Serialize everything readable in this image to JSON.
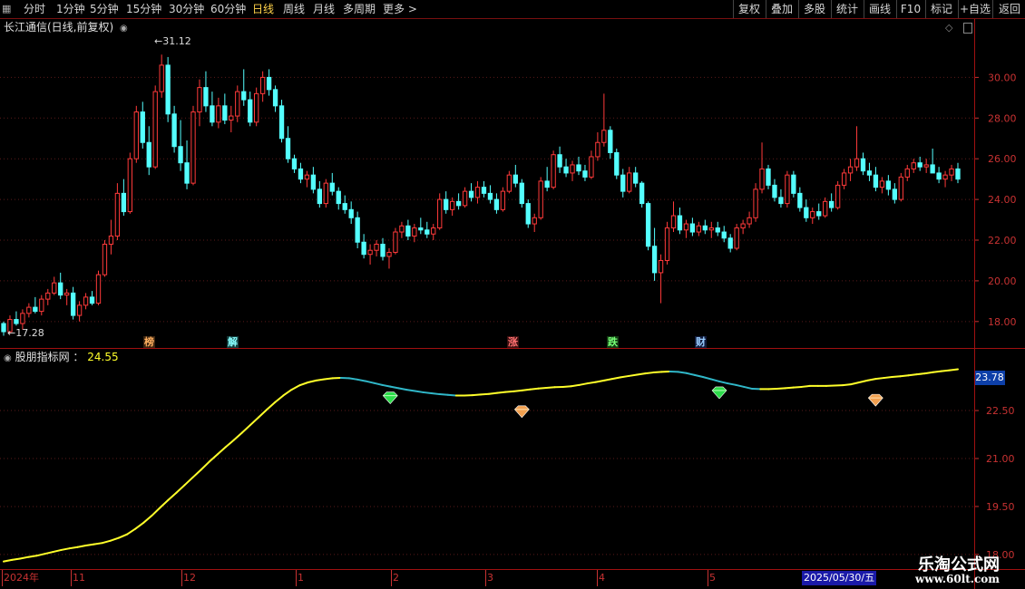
{
  "toolbar": {
    "periods": [
      "分时",
      "1分钟",
      "5分钟",
      "15分钟",
      "30分钟",
      "60分钟",
      "日线",
      "周线",
      "月线",
      "多周期",
      "更多"
    ],
    "active": "日线",
    "right_buttons": [
      "复权",
      "叠加",
      "多股",
      "统计",
      "画线",
      "F10",
      "标记",
      "+自选",
      "返回"
    ]
  },
  "main_panel": {
    "title": "长江通信(日线,前复权)",
    "high_label": "31.12",
    "low_label": "17.28",
    "events": [
      "榜",
      "解",
      "涨",
      "跌",
      "财"
    ]
  },
  "indicator_panel": {
    "title": "股朋指标网",
    "value": "24.55",
    "current_box": "23.78"
  },
  "footer": {
    "date_box": "2025/05/30/五",
    "watermark_title": "乐淘公式网",
    "watermark_url": "www.60lt.com"
  },
  "colors": {
    "up": "#ff3a3a",
    "down": "#54ffff",
    "line_up": "#ffff2a",
    "line_down": "#30b7c8",
    "grid": "#5a1a1a",
    "axis": "#c83232"
  },
  "chart_data": [
    {
      "type": "candlestick",
      "ylim": [
        16.7,
        32.2
      ],
      "y_ticks": [
        18,
        20,
        22,
        24,
        26,
        28,
        30
      ],
      "x_month_labels": [
        "2024年",
        "11",
        "12",
        "1",
        "2",
        "3",
        "4",
        "5"
      ],
      "ohlc": [
        [
          17.9,
          18.0,
          17.3,
          17.5
        ],
        [
          17.5,
          18.3,
          17.4,
          18.1
        ],
        [
          18.1,
          18.5,
          17.8,
          17.9
        ],
        [
          17.9,
          18.6,
          17.6,
          18.4
        ],
        [
          18.4,
          18.9,
          18.2,
          18.7
        ],
        [
          18.7,
          19.2,
          18.4,
          18.5
        ],
        [
          18.5,
          19.3,
          18.3,
          19.1
        ],
        [
          19.1,
          19.6,
          18.8,
          19.4
        ],
        [
          19.4,
          20.2,
          19.3,
          19.9
        ],
        [
          19.9,
          20.4,
          19.1,
          19.3
        ],
        [
          19.3,
          19.6,
          18.8,
          19.4
        ],
        [
          19.4,
          19.7,
          18.1,
          18.3
        ],
        [
          18.3,
          19.0,
          18.0,
          18.8
        ],
        [
          18.8,
          19.4,
          18.6,
          19.2
        ],
        [
          19.2,
          19.5,
          18.8,
          18.9
        ],
        [
          18.9,
          20.5,
          18.8,
          20.3
        ],
        [
          20.3,
          22.0,
          20.2,
          21.8
        ],
        [
          21.8,
          23.0,
          21.3,
          22.2
        ],
        [
          22.2,
          24.8,
          22.0,
          24.3
        ],
        [
          24.3,
          25.0,
          23.2,
          23.4
        ],
        [
          23.4,
          26.3,
          23.3,
          26.0
        ],
        [
          26.0,
          28.6,
          25.8,
          28.3
        ],
        [
          28.3,
          28.8,
          26.5,
          26.8
        ],
        [
          26.8,
          27.6,
          25.2,
          25.6
        ],
        [
          25.6,
          29.6,
          25.5,
          29.3
        ],
        [
          29.3,
          31.12,
          29.0,
          30.6
        ],
        [
          30.6,
          31.0,
          27.8,
          28.2
        ],
        [
          28.2,
          28.6,
          26.3,
          26.6
        ],
        [
          26.6,
          27.9,
          25.4,
          25.8
        ],
        [
          25.8,
          26.9,
          24.5,
          24.8
        ],
        [
          24.8,
          28.6,
          24.7,
          28.3
        ],
        [
          28.3,
          29.9,
          27.6,
          29.5
        ],
        [
          29.5,
          30.3,
          28.3,
          28.6
        ],
        [
          28.6,
          29.3,
          27.6,
          27.8
        ],
        [
          27.8,
          29.0,
          27.5,
          28.6
        ],
        [
          28.6,
          29.2,
          27.7,
          27.9
        ],
        [
          27.9,
          28.6,
          27.3,
          28.1
        ],
        [
          28.1,
          29.6,
          27.8,
          29.3
        ],
        [
          29.3,
          30.4,
          28.6,
          28.9
        ],
        [
          28.9,
          29.3,
          27.6,
          27.8
        ],
        [
          27.8,
          29.5,
          27.6,
          29.2
        ],
        [
          29.2,
          30.3,
          28.8,
          30.0
        ],
        [
          30.0,
          30.4,
          29.1,
          29.4
        ],
        [
          29.4,
          29.6,
          28.3,
          28.6
        ],
        [
          28.6,
          28.9,
          26.8,
          27.0
        ],
        [
          27.0,
          27.6,
          25.8,
          26.0
        ],
        [
          26.0,
          26.2,
          25.3,
          25.5
        ],
        [
          25.5,
          25.8,
          24.8,
          25.0
        ],
        [
          25.0,
          25.4,
          24.6,
          25.2
        ],
        [
          25.2,
          25.6,
          24.3,
          24.5
        ],
        [
          24.5,
          24.9,
          23.6,
          23.8
        ],
        [
          23.8,
          25.0,
          23.6,
          24.8
        ],
        [
          24.8,
          25.3,
          24.2,
          24.4
        ],
        [
          24.4,
          24.6,
          23.5,
          23.8
        ],
        [
          23.8,
          24.2,
          23.3,
          23.5
        ],
        [
          23.5,
          23.9,
          22.8,
          23.1
        ],
        [
          23.1,
          23.4,
          21.6,
          21.9
        ],
        [
          21.9,
          22.3,
          21.1,
          21.3
        ],
        [
          21.3,
          21.8,
          20.8,
          21.5
        ],
        [
          21.5,
          22.0,
          21.2,
          21.8
        ],
        [
          21.8,
          22.1,
          21.0,
          21.2
        ],
        [
          21.2,
          21.6,
          20.6,
          21.4
        ],
        [
          21.4,
          22.6,
          21.3,
          22.4
        ],
        [
          22.4,
          22.9,
          22.1,
          22.7
        ],
        [
          22.7,
          23.0,
          22.0,
          22.2
        ],
        [
          22.2,
          22.8,
          21.9,
          22.6
        ],
        [
          22.6,
          23.1,
          22.3,
          22.5
        ],
        [
          22.5,
          22.9,
          22.1,
          22.3
        ],
        [
          22.3,
          22.8,
          22.0,
          22.6
        ],
        [
          22.6,
          24.3,
          22.5,
          24.0
        ],
        [
          24.0,
          24.4,
          23.3,
          23.5
        ],
        [
          23.5,
          24.1,
          23.2,
          23.9
        ],
        [
          23.9,
          24.3,
          23.5,
          23.7
        ],
        [
          23.7,
          24.6,
          23.6,
          24.4
        ],
        [
          24.4,
          24.8,
          23.9,
          24.1
        ],
        [
          24.1,
          24.9,
          23.8,
          24.6
        ],
        [
          24.6,
          24.9,
          24.1,
          24.3
        ],
        [
          24.3,
          24.7,
          23.8,
          24.0
        ],
        [
          24.0,
          24.3,
          23.3,
          23.5
        ],
        [
          23.5,
          24.6,
          23.4,
          24.4
        ],
        [
          24.4,
          25.4,
          24.3,
          25.2
        ],
        [
          25.2,
          25.7,
          24.6,
          24.8
        ],
        [
          24.8,
          25.0,
          23.6,
          23.8
        ],
        [
          23.8,
          24.0,
          22.6,
          22.8
        ],
        [
          22.8,
          23.3,
          22.4,
          23.1
        ],
        [
          23.1,
          25.1,
          23.0,
          24.9
        ],
        [
          24.9,
          25.6,
          24.4,
          24.6
        ],
        [
          24.6,
          26.4,
          24.5,
          26.2
        ],
        [
          26.2,
          26.6,
          25.3,
          25.6
        ],
        [
          25.6,
          26.0,
          25.1,
          25.3
        ],
        [
          25.3,
          25.9,
          24.9,
          25.7
        ],
        [
          25.7,
          26.1,
          25.2,
          25.4
        ],
        [
          25.4,
          25.7,
          24.9,
          25.1
        ],
        [
          25.1,
          26.4,
          25.0,
          26.1
        ],
        [
          26.1,
          27.3,
          25.9,
          26.8
        ],
        [
          26.8,
          29.2,
          26.6,
          27.4
        ],
        [
          27.4,
          27.6,
          26.0,
          26.3
        ],
        [
          26.3,
          26.5,
          25.0,
          25.2
        ],
        [
          25.2,
          25.5,
          24.1,
          24.4
        ],
        [
          24.4,
          25.6,
          24.3,
          25.3
        ],
        [
          25.3,
          25.6,
          24.6,
          24.8
        ],
        [
          24.8,
          24.9,
          23.6,
          23.8
        ],
        [
          23.8,
          23.9,
          21.5,
          21.7
        ],
        [
          21.7,
          22.6,
          20.0,
          20.4
        ],
        [
          20.4,
          21.3,
          18.9,
          21.0
        ],
        [
          21.0,
          22.9,
          20.8,
          22.6
        ],
        [
          22.6,
          23.9,
          22.4,
          23.2
        ],
        [
          23.2,
          23.6,
          22.3,
          22.5
        ],
        [
          22.5,
          23.0,
          22.1,
          22.8
        ],
        [
          22.8,
          23.1,
          22.2,
          22.4
        ],
        [
          22.4,
          22.9,
          22.2,
          22.7
        ],
        [
          22.7,
          23.0,
          22.3,
          22.5
        ],
        [
          22.5,
          22.9,
          22.1,
          22.6
        ],
        [
          22.6,
          22.9,
          22.2,
          22.4
        ],
        [
          22.4,
          22.7,
          21.9,
          22.1
        ],
        [
          22.1,
          22.3,
          21.4,
          21.6
        ],
        [
          21.6,
          22.8,
          21.5,
          22.6
        ],
        [
          22.6,
          23.0,
          22.3,
          22.8
        ],
        [
          22.8,
          23.4,
          22.6,
          23.1
        ],
        [
          23.1,
          24.8,
          22.9,
          24.5
        ],
        [
          24.5,
          26.8,
          24.3,
          25.5
        ],
        [
          25.5,
          25.7,
          24.5,
          24.7
        ],
        [
          24.7,
          25.0,
          23.9,
          24.1
        ],
        [
          24.1,
          24.5,
          23.6,
          23.8
        ],
        [
          23.8,
          25.4,
          23.6,
          25.2
        ],
        [
          25.2,
          25.4,
          24.1,
          24.3
        ],
        [
          24.3,
          24.6,
          23.4,
          23.6
        ],
        [
          23.6,
          24.0,
          22.9,
          23.1
        ],
        [
          23.1,
          23.6,
          22.8,
          23.4
        ],
        [
          23.4,
          23.8,
          23.0,
          23.2
        ],
        [
          23.2,
          24.1,
          23.1,
          23.9
        ],
        [
          23.9,
          24.3,
          23.4,
          23.6
        ],
        [
          23.6,
          24.9,
          23.5,
          24.7
        ],
        [
          24.7,
          25.5,
          24.5,
          25.3
        ],
        [
          25.3,
          26.0,
          24.9,
          25.6
        ],
        [
          25.6,
          27.6,
          25.4,
          26.0
        ],
        [
          26.0,
          26.3,
          25.2,
          25.4
        ],
        [
          25.4,
          25.8,
          24.9,
          25.2
        ],
        [
          25.2,
          25.6,
          24.4,
          24.6
        ],
        [
          24.6,
          25.1,
          24.3,
          24.9
        ],
        [
          24.9,
          25.2,
          24.2,
          24.5
        ],
        [
          24.5,
          24.8,
          23.8,
          24.0
        ],
        [
          24.0,
          25.3,
          23.9,
          25.1
        ],
        [
          25.1,
          25.7,
          24.9,
          25.5
        ],
        [
          25.5,
          26.0,
          25.3,
          25.8
        ],
        [
          25.8,
          26.1,
          25.4,
          25.6
        ],
        [
          25.6,
          26.0,
          25.3,
          25.7
        ],
        [
          25.7,
          26.5,
          25.4,
          25.3
        ],
        [
          25.3,
          25.6,
          24.8,
          25.0
        ],
        [
          25.0,
          25.4,
          24.6,
          25.2
        ],
        [
          25.2,
          25.7,
          24.9,
          25.5
        ],
        [
          25.5,
          25.8,
          24.8,
          25.0
        ]
      ]
    },
    {
      "type": "line",
      "ylim": [
        17.6,
        24.4
      ],
      "y_ticks": [
        18.0,
        19.5,
        21.0,
        22.5
      ],
      "y_tick_labels": [
        "18.00",
        "19.50",
        "21.00",
        "22.50"
      ],
      "values": [
        17.78,
        17.83,
        17.87,
        17.92,
        17.96,
        18.02,
        18.08,
        18.14,
        18.19,
        18.23,
        18.28,
        18.32,
        18.36,
        18.43,
        18.52,
        18.63,
        18.8,
        18.99,
        19.21,
        19.46,
        19.7,
        19.93,
        20.17,
        20.41,
        20.65,
        20.9,
        21.13,
        21.36,
        21.58,
        21.81,
        22.05,
        22.29,
        22.53,
        22.76,
        22.97,
        23.15,
        23.29,
        23.38,
        23.44,
        23.48,
        23.51,
        23.52,
        23.51,
        23.47,
        23.42,
        23.36,
        23.3,
        23.25,
        23.2,
        23.15,
        23.11,
        23.07,
        23.04,
        23.01,
        22.99,
        22.97,
        22.97,
        22.98,
        23.0,
        23.02,
        23.05,
        23.08,
        23.1,
        23.13,
        23.16,
        23.19,
        23.21,
        23.23,
        23.24,
        23.26,
        23.3,
        23.35,
        23.39,
        23.44,
        23.49,
        23.54,
        23.58,
        23.62,
        23.66,
        23.69,
        23.71,
        23.72,
        23.71,
        23.67,
        23.61,
        23.55,
        23.48,
        23.41,
        23.35,
        23.3,
        23.24,
        23.18,
        23.17,
        23.17,
        23.18,
        23.2,
        23.22,
        23.24,
        23.27,
        23.27,
        23.27,
        23.28,
        23.29,
        23.32,
        23.38,
        23.44,
        23.49,
        23.52,
        23.55,
        23.57,
        23.6,
        23.63,
        23.66,
        23.7,
        23.73,
        23.76,
        23.79
      ],
      "markers": [
        {
          "index": 47,
          "kind": "sell"
        },
        {
          "index": 63,
          "kind": "buy"
        },
        {
          "index": 87,
          "kind": "sell"
        },
        {
          "index": 106,
          "kind": "buy"
        }
      ]
    }
  ]
}
